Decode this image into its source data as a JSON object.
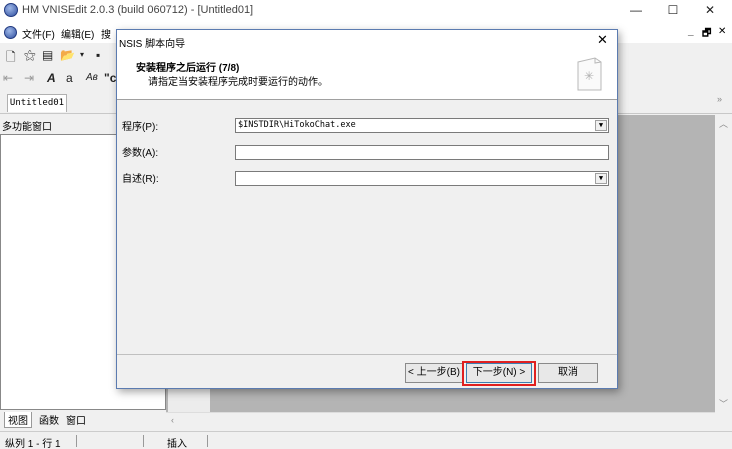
{
  "app": {
    "title": "HM VNISEdit 2.0.3 (build 060712) - [Untitled01]",
    "window_controls": {
      "minimize": "—",
      "maximize": "☐",
      "close": "✕"
    }
  },
  "menu": {
    "items": [
      "文件(F)",
      "编辑(E)",
      "搜"
    ],
    "mdi_controls": [
      "_",
      "🗗",
      "✕"
    ]
  },
  "toolbar": {
    "row2_partial": "\"c"
  },
  "tabs": {
    "document": "Untitled01",
    "scroll_glyph": "»"
  },
  "left_panel": {
    "title": "多功能窗口",
    "tabs": [
      "视图",
      "函数",
      "窗口"
    ]
  },
  "status": {
    "position": "纵列 1 - 行 1",
    "mode": "插入"
  },
  "dialog": {
    "title": "NSIS 脚本向导",
    "close": "✕",
    "heading": "安装程序之后运行 (7/8)",
    "subtitle": "请指定当安装程序完成时要运行的动作。",
    "fields": [
      {
        "label": "程序(P):",
        "value": "$INSTDIR\\HiTokoChat.exe",
        "dropdown": true
      },
      {
        "label": "参数(A):",
        "value": "",
        "dropdown": false
      },
      {
        "label": "自述(R):",
        "value": "",
        "dropdown": true
      }
    ],
    "buttons": {
      "back": "< 上一步(B)",
      "next": "下一步(N) >",
      "cancel": "取消"
    },
    "highlight_color": "#e02020"
  }
}
